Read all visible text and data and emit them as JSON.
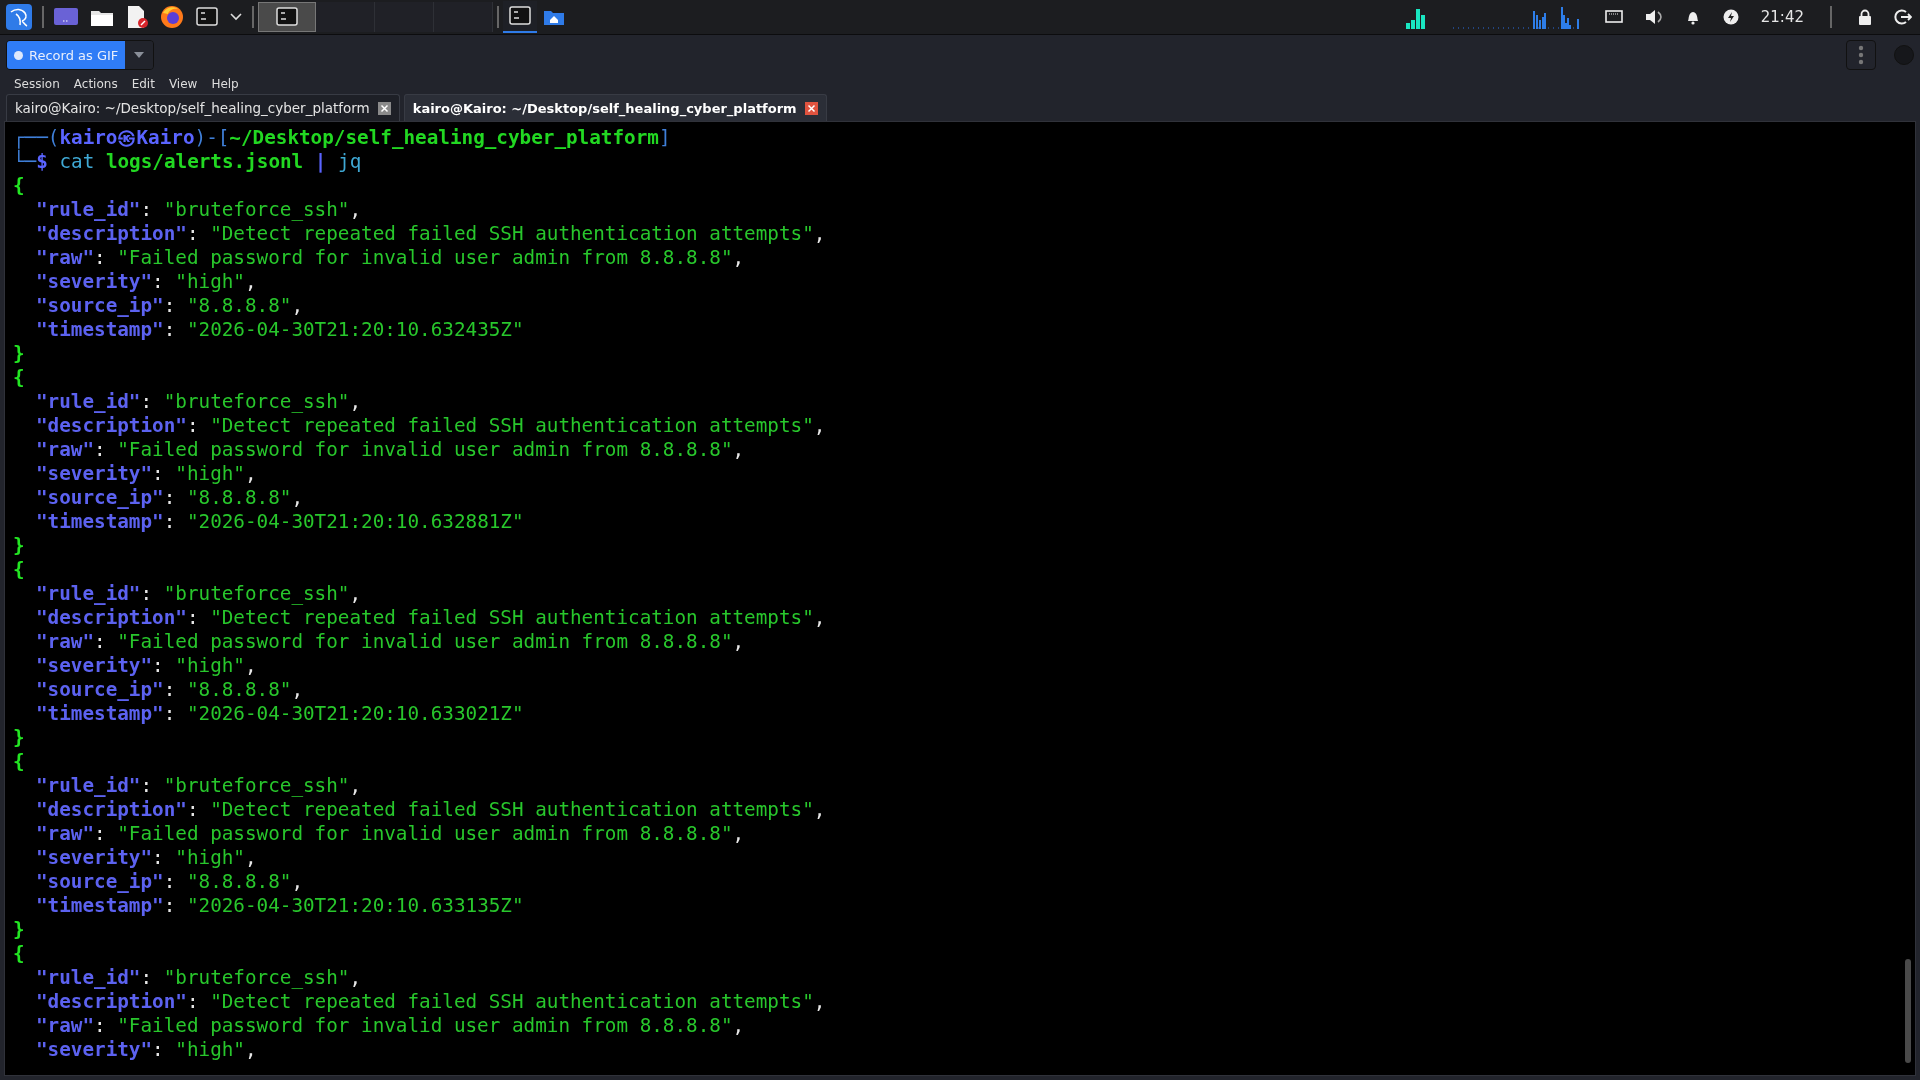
{
  "taskbar": {
    "launchers": [
      {
        "kind": "logo"
      },
      {
        "kind": "desktop"
      },
      {
        "kind": "files"
      },
      {
        "kind": "editor"
      },
      {
        "kind": "browser"
      },
      {
        "kind": "terminal"
      },
      {
        "kind": "chevron"
      }
    ],
    "windows": [
      {
        "kind": "terminal",
        "selected": true
      },
      {
        "kind": "empty",
        "selected": false
      },
      {
        "kind": "empty",
        "selected": false
      },
      {
        "kind": "empty",
        "selected": false
      }
    ],
    "workspaces": [
      {
        "kind": "terminal",
        "selected": true
      },
      {
        "kind": "home",
        "selected": false
      }
    ],
    "clock": "21:42"
  },
  "recorder": {
    "button": "Record as GIF"
  },
  "menu": [
    "Session",
    "Actions",
    "Edit",
    "View",
    "Help"
  ],
  "tabs": [
    {
      "label": "kairo@Kairo: ~/Desktop/self_healing_cyber_platform",
      "selected": false
    },
    {
      "label": "kairo@Kairo: ~/Desktop/self_healing_cyber_platform",
      "selected": true
    }
  ],
  "terminal": {
    "lines": [
      {
        "indent": false,
        "segments": [
          {
            "text": "┌──(",
            "kind": "frame"
          },
          {
            "text": "kairo㉿Kairo",
            "kind": "user"
          },
          {
            "text": ")-[",
            "kind": "frame"
          },
          {
            "text": "~/Desktop/self_healing_cyber_platform",
            "kind": "path"
          },
          {
            "text": "]",
            "kind": "frame"
          }
        ]
      },
      {
        "indent": false,
        "segments": [
          {
            "text": "└─",
            "kind": "frame"
          },
          {
            "text": "$ ",
            "kind": "user"
          },
          {
            "text": "cat ",
            "kind": "cmd"
          },
          {
            "text": "logs/alerts.jsonl ",
            "kind": "arg"
          },
          {
            "text": "| ",
            "kind": "user"
          },
          {
            "text": "jq",
            "kind": "cmd"
          }
        ]
      },
      {
        "indent": false,
        "segments": [
          {
            "text": "{",
            "kind": "brace"
          }
        ]
      },
      {
        "indent": true,
        "segments": [
          {
            "text": "\"rule_id\"",
            "kind": "key"
          },
          {
            "text": ": ",
            "kind": "punct"
          },
          {
            "text": "\"bruteforce_ssh\"",
            "kind": "str"
          },
          {
            "text": ",",
            "kind": "punct"
          }
        ]
      },
      {
        "indent": true,
        "segments": [
          {
            "text": "\"description\"",
            "kind": "key"
          },
          {
            "text": ": ",
            "kind": "punct"
          },
          {
            "text": "\"Detect repeated failed SSH authentication attempts\"",
            "kind": "str"
          },
          {
            "text": ",",
            "kind": "punct"
          }
        ]
      },
      {
        "indent": true,
        "segments": [
          {
            "text": "\"raw\"",
            "kind": "key"
          },
          {
            "text": ": ",
            "kind": "punct"
          },
          {
            "text": "\"Failed password for invalid user admin from 8.8.8.8\"",
            "kind": "str"
          },
          {
            "text": ",",
            "kind": "punct"
          }
        ]
      },
      {
        "indent": true,
        "segments": [
          {
            "text": "\"severity\"",
            "kind": "key"
          },
          {
            "text": ": ",
            "kind": "punct"
          },
          {
            "text": "\"high\"",
            "kind": "str"
          },
          {
            "text": ",",
            "kind": "punct"
          }
        ]
      },
      {
        "indent": true,
        "segments": [
          {
            "text": "\"source_ip\"",
            "kind": "key"
          },
          {
            "text": ": ",
            "kind": "punct"
          },
          {
            "text": "\"8.8.8.8\"",
            "kind": "str"
          },
          {
            "text": ",",
            "kind": "punct"
          }
        ]
      },
      {
        "indent": true,
        "segments": [
          {
            "text": "\"timestamp\"",
            "kind": "key"
          },
          {
            "text": ": ",
            "kind": "punct"
          },
          {
            "text": "\"2026-04-30T21:20:10.632435Z\"",
            "kind": "str"
          }
        ]
      },
      {
        "indent": false,
        "segments": [
          {
            "text": "}",
            "kind": "brace"
          }
        ]
      },
      {
        "indent": false,
        "segments": [
          {
            "text": "{",
            "kind": "brace"
          }
        ]
      },
      {
        "indent": true,
        "segments": [
          {
            "text": "\"rule_id\"",
            "kind": "key"
          },
          {
            "text": ": ",
            "kind": "punct"
          },
          {
            "text": "\"bruteforce_ssh\"",
            "kind": "str"
          },
          {
            "text": ",",
            "kind": "punct"
          }
        ]
      },
      {
        "indent": true,
        "segments": [
          {
            "text": "\"description\"",
            "kind": "key"
          },
          {
            "text": ": ",
            "kind": "punct"
          },
          {
            "text": "\"Detect repeated failed SSH authentication attempts\"",
            "kind": "str"
          },
          {
            "text": ",",
            "kind": "punct"
          }
        ]
      },
      {
        "indent": true,
        "segments": [
          {
            "text": "\"raw\"",
            "kind": "key"
          },
          {
            "text": ": ",
            "kind": "punct"
          },
          {
            "text": "\"Failed password for invalid user admin from 8.8.8.8\"",
            "kind": "str"
          },
          {
            "text": ",",
            "kind": "punct"
          }
        ]
      },
      {
        "indent": true,
        "segments": [
          {
            "text": "\"severity\"",
            "kind": "key"
          },
          {
            "text": ": ",
            "kind": "punct"
          },
          {
            "text": "\"high\"",
            "kind": "str"
          },
          {
            "text": ",",
            "kind": "punct"
          }
        ]
      },
      {
        "indent": true,
        "segments": [
          {
            "text": "\"source_ip\"",
            "kind": "key"
          },
          {
            "text": ": ",
            "kind": "punct"
          },
          {
            "text": "\"8.8.8.8\"",
            "kind": "str"
          },
          {
            "text": ",",
            "kind": "punct"
          }
        ]
      },
      {
        "indent": true,
        "segments": [
          {
            "text": "\"timestamp\"",
            "kind": "key"
          },
          {
            "text": ": ",
            "kind": "punct"
          },
          {
            "text": "\"2026-04-30T21:20:10.632881Z\"",
            "kind": "str"
          }
        ]
      },
      {
        "indent": false,
        "segments": [
          {
            "text": "}",
            "kind": "brace"
          }
        ]
      },
      {
        "indent": false,
        "segments": [
          {
            "text": "{",
            "kind": "brace"
          }
        ]
      },
      {
        "indent": true,
        "segments": [
          {
            "text": "\"rule_id\"",
            "kind": "key"
          },
          {
            "text": ": ",
            "kind": "punct"
          },
          {
            "text": "\"bruteforce_ssh\"",
            "kind": "str"
          },
          {
            "text": ",",
            "kind": "punct"
          }
        ]
      },
      {
        "indent": true,
        "segments": [
          {
            "text": "\"description\"",
            "kind": "key"
          },
          {
            "text": ": ",
            "kind": "punct"
          },
          {
            "text": "\"Detect repeated failed SSH authentication attempts\"",
            "kind": "str"
          },
          {
            "text": ",",
            "kind": "punct"
          }
        ]
      },
      {
        "indent": true,
        "segments": [
          {
            "text": "\"raw\"",
            "kind": "key"
          },
          {
            "text": ": ",
            "kind": "punct"
          },
          {
            "text": "\"Failed password for invalid user admin from 8.8.8.8\"",
            "kind": "str"
          },
          {
            "text": ",",
            "kind": "punct"
          }
        ]
      },
      {
        "indent": true,
        "segments": [
          {
            "text": "\"severity\"",
            "kind": "key"
          },
          {
            "text": ": ",
            "kind": "punct"
          },
          {
            "text": "\"high\"",
            "kind": "str"
          },
          {
            "text": ",",
            "kind": "punct"
          }
        ]
      },
      {
        "indent": true,
        "segments": [
          {
            "text": "\"source_ip\"",
            "kind": "key"
          },
          {
            "text": ": ",
            "kind": "punct"
          },
          {
            "text": "\"8.8.8.8\"",
            "kind": "str"
          },
          {
            "text": ",",
            "kind": "punct"
          }
        ]
      },
      {
        "indent": true,
        "segments": [
          {
            "text": "\"timestamp\"",
            "kind": "key"
          },
          {
            "text": ": ",
            "kind": "punct"
          },
          {
            "text": "\"2026-04-30T21:20:10.633021Z\"",
            "kind": "str"
          }
        ]
      },
      {
        "indent": false,
        "segments": [
          {
            "text": "}",
            "kind": "brace"
          }
        ]
      },
      {
        "indent": false,
        "segments": [
          {
            "text": "{",
            "kind": "brace"
          }
        ]
      },
      {
        "indent": true,
        "segments": [
          {
            "text": "\"rule_id\"",
            "kind": "key"
          },
          {
            "text": ": ",
            "kind": "punct"
          },
          {
            "text": "\"bruteforce_ssh\"",
            "kind": "str"
          },
          {
            "text": ",",
            "kind": "punct"
          }
        ]
      },
      {
        "indent": true,
        "segments": [
          {
            "text": "\"description\"",
            "kind": "key"
          },
          {
            "text": ": ",
            "kind": "punct"
          },
          {
            "text": "\"Detect repeated failed SSH authentication attempts\"",
            "kind": "str"
          },
          {
            "text": ",",
            "kind": "punct"
          }
        ]
      },
      {
        "indent": true,
        "segments": [
          {
            "text": "\"raw\"",
            "kind": "key"
          },
          {
            "text": ": ",
            "kind": "punct"
          },
          {
            "text": "\"Failed password for invalid user admin from 8.8.8.8\"",
            "kind": "str"
          },
          {
            "text": ",",
            "kind": "punct"
          }
        ]
      },
      {
        "indent": true,
        "segments": [
          {
            "text": "\"severity\"",
            "kind": "key"
          },
          {
            "text": ": ",
            "kind": "punct"
          },
          {
            "text": "\"high\"",
            "kind": "str"
          },
          {
            "text": ",",
            "kind": "punct"
          }
        ]
      },
      {
        "indent": true,
        "segments": [
          {
            "text": "\"source_ip\"",
            "kind": "key"
          },
          {
            "text": ": ",
            "kind": "punct"
          },
          {
            "text": "\"8.8.8.8\"",
            "kind": "str"
          },
          {
            "text": ",",
            "kind": "punct"
          }
        ]
      },
      {
        "indent": true,
        "segments": [
          {
            "text": "\"timestamp\"",
            "kind": "key"
          },
          {
            "text": ": ",
            "kind": "punct"
          },
          {
            "text": "\"2026-04-30T21:20:10.633135Z\"",
            "kind": "str"
          }
        ]
      },
      {
        "indent": false,
        "segments": [
          {
            "text": "}",
            "kind": "brace"
          }
        ]
      },
      {
        "indent": false,
        "segments": [
          {
            "text": "{",
            "kind": "brace"
          }
        ]
      },
      {
        "indent": true,
        "segments": [
          {
            "text": "\"rule_id\"",
            "kind": "key"
          },
          {
            "text": ": ",
            "kind": "punct"
          },
          {
            "text": "\"bruteforce_ssh\"",
            "kind": "str"
          },
          {
            "text": ",",
            "kind": "punct"
          }
        ]
      },
      {
        "indent": true,
        "segments": [
          {
            "text": "\"description\"",
            "kind": "key"
          },
          {
            "text": ": ",
            "kind": "punct"
          },
          {
            "text": "\"Detect repeated failed SSH authentication attempts\"",
            "kind": "str"
          },
          {
            "text": ",",
            "kind": "punct"
          }
        ]
      },
      {
        "indent": true,
        "segments": [
          {
            "text": "\"raw\"",
            "kind": "key"
          },
          {
            "text": ": ",
            "kind": "punct"
          },
          {
            "text": "\"Failed password for invalid user admin from 8.8.8.8\"",
            "kind": "str"
          },
          {
            "text": ",",
            "kind": "punct"
          }
        ]
      },
      {
        "indent": true,
        "segments": [
          {
            "text": "\"severity\"",
            "kind": "key"
          },
          {
            "text": ": ",
            "kind": "punct"
          },
          {
            "text": "\"high\"",
            "kind": "str"
          },
          {
            "text": ",",
            "kind": "punct"
          }
        ]
      }
    ]
  }
}
